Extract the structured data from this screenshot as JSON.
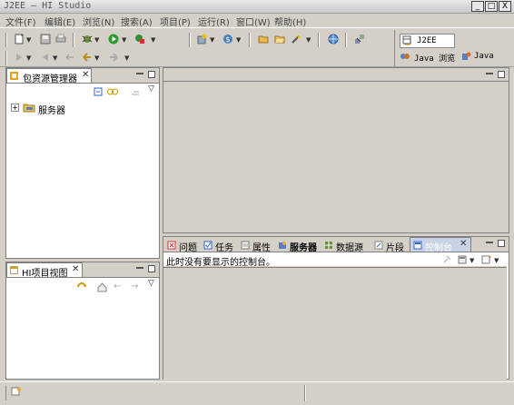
{
  "window": {
    "title": "J2EE — HI Studio",
    "buttons": {
      "minimize": "_",
      "maximize": "□",
      "close": "X"
    }
  },
  "menu": [
    {
      "label": "文件(F)"
    },
    {
      "label": "编辑(E)"
    },
    {
      "label": "浏览(N)"
    },
    {
      "label": "搜索(A)"
    },
    {
      "label": "项目(P)"
    },
    {
      "label": "运行(R)"
    },
    {
      "label": "窗口(W)"
    },
    {
      "label": "帮助(H)"
    }
  ],
  "perspectives": {
    "active": "J2EE",
    "others": [
      "Java 浏览",
      "Java"
    ]
  },
  "package_explorer": {
    "title": "包资源管理器",
    "tree": [
      {
        "label": "服务器",
        "expander": "+"
      }
    ]
  },
  "hi_project_view": {
    "title": "HI项目视图"
  },
  "bottom_tabs": [
    {
      "label": "问题"
    },
    {
      "label": "任务"
    },
    {
      "label": "属性"
    },
    {
      "label": "服务器"
    },
    {
      "label": "数据源"
    },
    {
      "label": "片段"
    },
    {
      "label": "控制台"
    }
  ],
  "console": {
    "message": "此时没有要显示的控制台。"
  },
  "colors": {
    "chrome": "#d4d0c8",
    "panel_bg": "#ffffff",
    "active_tab": "#ffffff",
    "console_tab_highlight": "#c9d3e6"
  },
  "icons": [
    "new-icon",
    "save-icon",
    "print-icon",
    "debug-icon",
    "run-icon",
    "external-tools-icon",
    "new-server-icon",
    "web-service-icon",
    "open-folder-icon",
    "wizard-icon",
    "globe-icon",
    "deploy-icon"
  ]
}
